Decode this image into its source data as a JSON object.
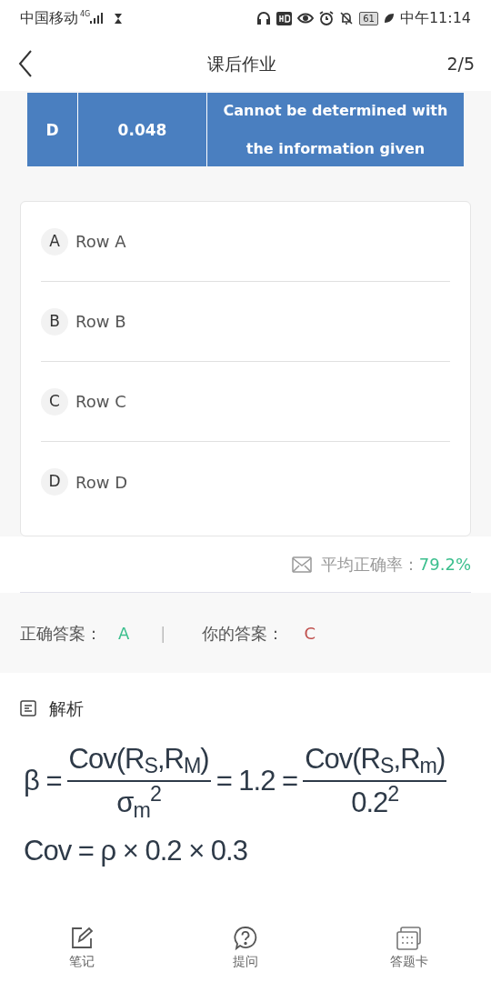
{
  "status_bar": {
    "carrier": "中国移动",
    "network": "4G",
    "battery": "61",
    "time": "中午11:14"
  },
  "header": {
    "title": "课后作业",
    "progress": "2/5"
  },
  "table_row": {
    "cells": [
      "D",
      "0.048",
      "Cannot be determined with the information given"
    ]
  },
  "options": [
    {
      "letter": "A",
      "label": "Row A"
    },
    {
      "letter": "B",
      "label": "Row B"
    },
    {
      "letter": "C",
      "label": "Row C"
    },
    {
      "letter": "D",
      "label": "Row D"
    }
  ],
  "stats": {
    "label": "平均正确率：",
    "value": "79.2%"
  },
  "answers": {
    "correct_label": "正确答案：",
    "correct": "A",
    "separator": "|",
    "yours_label": "你的答案：",
    "yours": "C"
  },
  "analysis": {
    "title": "解析",
    "formula": {
      "lhs": "β =",
      "frac1_num": "Cov(R$_{S}$,R$_{M}$)",
      "frac1_den": "σ$_{m}$$^{2}$",
      "mid": "= 1.2 =",
      "frac2_num": "Cov(R$_{S}$,R$_{m}$)",
      "frac2_den": "0.2$^{2}$",
      "line2": "Cov = ρ × 0.2 × 0.3"
    }
  },
  "bottom_nav": [
    {
      "label": "笔记",
      "kind": "note"
    },
    {
      "label": "提问",
      "kind": "question"
    },
    {
      "label": "答题卡",
      "kind": "card"
    }
  ]
}
